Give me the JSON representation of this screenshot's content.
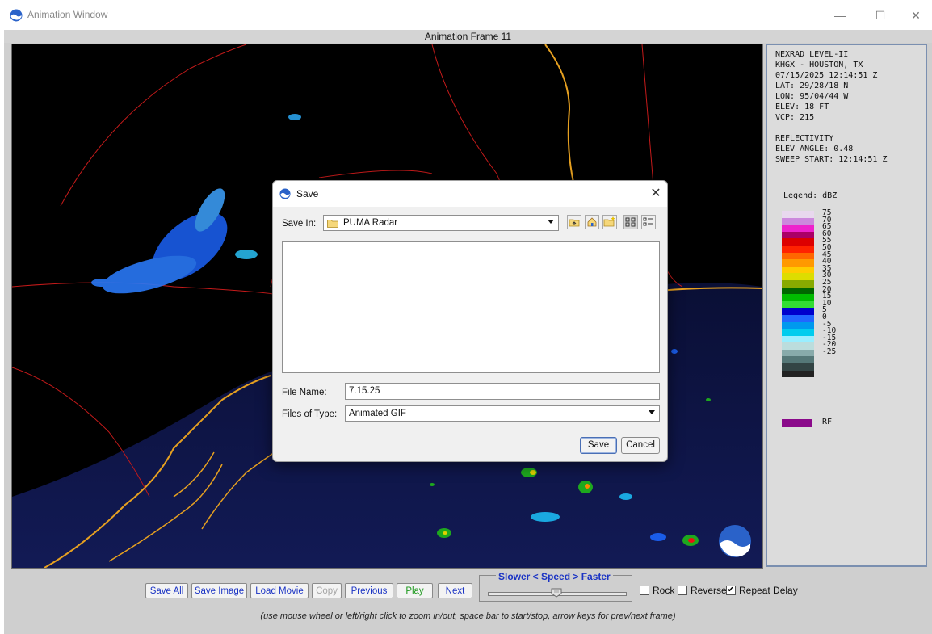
{
  "window": {
    "title": "Animation Window",
    "min_glyph": "—",
    "max_glyph": "☐",
    "close_glyph": "✕"
  },
  "frame_label": "Animation Frame 11",
  "info": {
    "lines": [
      "NEXRAD LEVEL-II",
      "KHGX - HOUSTON, TX",
      "07/15/2025 12:14:51 Z",
      "LAT: 29/28/18 N",
      "LON: 95/04/44 W",
      "ELEV: 18 FT",
      "VCP: 215",
      "REFLECTIVITY",
      "ELEV ANGLE: 0.48",
      "SWEEP START: 12:14:51 Z"
    ],
    "legend_title": "Legend: dBZ",
    "legend_labels": [
      "75",
      "70",
      "65",
      "60",
      "55",
      "50",
      "45",
      "40",
      "35",
      "30",
      "25",
      "20",
      "15",
      "10",
      "5",
      "0",
      "-5",
      "-10",
      "-15",
      "-20",
      "-25"
    ],
    "legend_colors": [
      "#e8d8ee",
      "#cc88dd",
      "#ee22cc",
      "#aa0066",
      "#dd0000",
      "#ff2200",
      "#ff6600",
      "#ff9900",
      "#ffcc00",
      "#dddd00",
      "#88aa00",
      "#006600",
      "#00bb00",
      "#33dd33",
      "#0000cc",
      "#2266ff",
      "#0099ee",
      "#00ccee",
      "#99eeff",
      "#bbdddd",
      "#88aaaa",
      "#557777",
      "#334444",
      "#222222"
    ],
    "rf_label": "RF"
  },
  "controls": {
    "save_all": "Save All",
    "save_image": "Save Image",
    "load_movie": "Load Movie",
    "copy": "Copy",
    "previous": "Previous",
    "play": "Play",
    "next": "Next",
    "speed_label": "Slower < Speed > Faster",
    "speed_level": 0.5,
    "rock": "Rock",
    "reverse": "Reverse",
    "repeat_delay": "Repeat Delay",
    "rock_checked": false,
    "reverse_checked": false,
    "repeat_delay_checked": true,
    "check_glyph": "✔",
    "hint": "(use mouse wheel or left/right click to zoom in/out, space bar to start/stop, arrow keys for prev/next frame)"
  },
  "dialog": {
    "title": "Save",
    "close_glyph": "✕",
    "save_in_label": "Save In:",
    "save_in_value": "PUMA Radar",
    "file_name_label": "File Name:",
    "file_name_value": "7.15.25",
    "file_type_label": "Files of Type:",
    "file_type_value": "Animated GIF",
    "save_button": "Save",
    "cancel_button": "Cancel"
  }
}
